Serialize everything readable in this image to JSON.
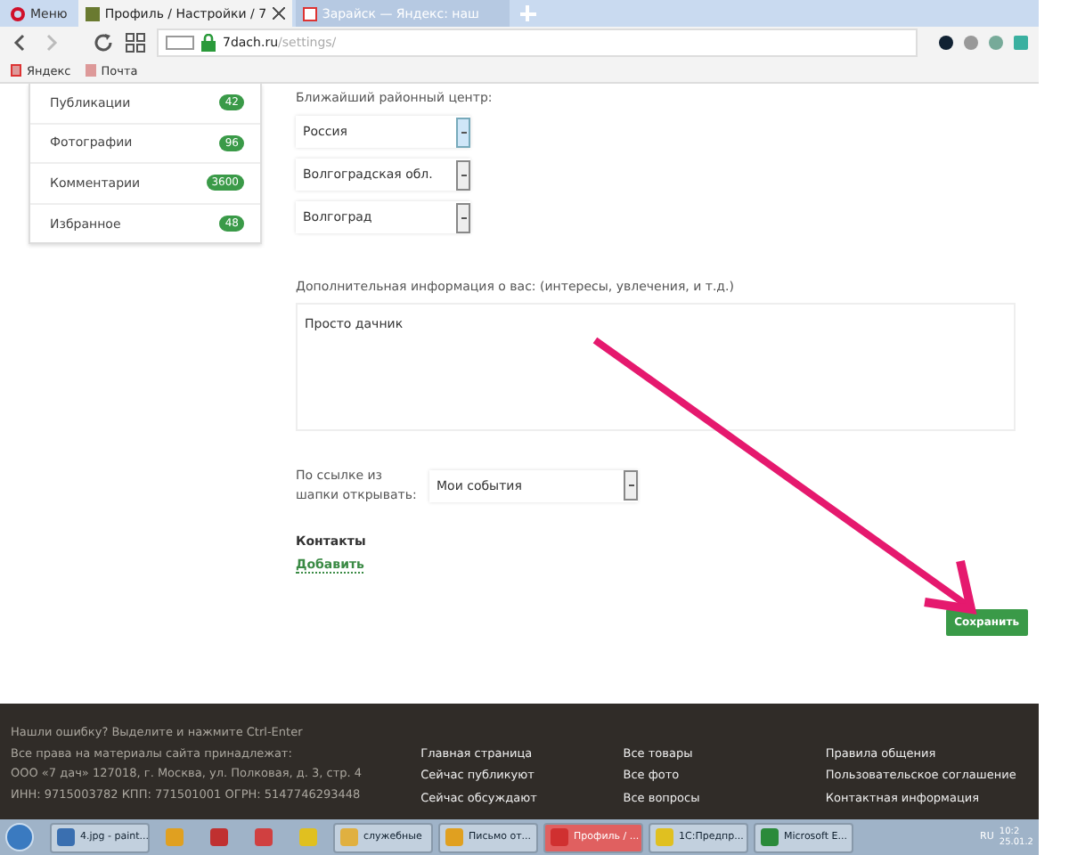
{
  "browser": {
    "menu": "Меню",
    "tabs": [
      {
        "title": "Профиль / Настройки / 7",
        "selected": true
      },
      {
        "title": "Зарайск — Яндекс: наш",
        "selected": false
      }
    ],
    "address": {
      "host": "7dach.ru",
      "path": "/settings/"
    },
    "bookmarks": [
      "Яндекс",
      "Почта"
    ]
  },
  "sidebar": {
    "items": [
      {
        "label": "Публикации",
        "count": "42"
      },
      {
        "label": "Фотографии",
        "count": "96"
      },
      {
        "label": "Комментарии",
        "count": "3600"
      },
      {
        "label": "Избранное",
        "count": "48"
      }
    ]
  },
  "form": {
    "region_label": "Ближайший районный центр:",
    "selects": [
      {
        "value": "Россия",
        "focused": true
      },
      {
        "value": "Волгоградская обл.",
        "focused": false
      },
      {
        "value": "Волгоград",
        "focused": false
      }
    ],
    "info_label": "Дополнительная информация о вас: (интересы, увлечения, и т.д.)",
    "info_value": "Просто дачник",
    "link_label": "По ссылке из шапки открывать:",
    "link_value": "Мои события",
    "contacts_title": "Контакты",
    "add_link": "Добавить",
    "save": "Сохранить"
  },
  "footer": {
    "left": [
      "Нашли ошибку? Выделите и нажмите Ctrl-Enter",
      "Все права на материалы сайта принадлежат:",
      "ООО «7 дач» 127018, г. Москва, ул. Полковая, д. 3, стр. 4",
      "ИНН: 9715003782 КПП: 771501001 ОГРН: 5147746293448"
    ],
    "columns": [
      [
        "Главная страница",
        "Сейчас публикуют",
        "Сейчас обсуждают"
      ],
      [
        "Все товары",
        "Все фото",
        "Все вопросы"
      ],
      [
        "Правила общения",
        "Пользовательское соглашение",
        "Контактная информация"
      ]
    ]
  },
  "taskbar": {
    "items": [
      {
        "kind": "app",
        "label": "4.jpg - paint...",
        "active": false
      },
      {
        "kind": "icon",
        "active": false
      },
      {
        "kind": "icon",
        "active": false
      },
      {
        "kind": "icon",
        "active": false
      },
      {
        "kind": "icon",
        "active": false
      },
      {
        "kind": "app",
        "label": "служебные",
        "active": false
      },
      {
        "kind": "app",
        "label": "Письмо от...",
        "active": false
      },
      {
        "kind": "app",
        "label": "Профиль / ...",
        "active": true
      },
      {
        "kind": "app",
        "label": "1С:Предпр...",
        "active": false
      },
      {
        "kind": "app",
        "label": "Microsoft E...",
        "active": false
      }
    ],
    "lang": "RU",
    "time": "10:2",
    "date": "25.01.2"
  }
}
